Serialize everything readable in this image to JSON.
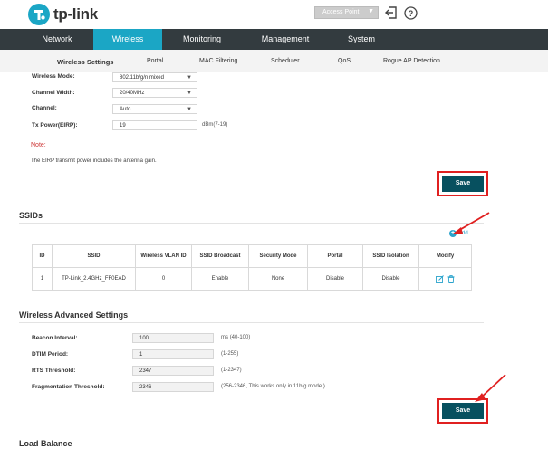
{
  "header": {
    "brand": "tp-link",
    "mode_select": "Access Point",
    "colors": {
      "brand_teal": "#1ba6c5",
      "nav_bg": "#333b3f"
    }
  },
  "main_nav": [
    "Network",
    "Wireless",
    "Monitoring",
    "Management",
    "System"
  ],
  "main_nav_active": "Wireless",
  "sub_nav": [
    "Wireless Settings",
    "Portal",
    "MAC Filtering",
    "Scheduler",
    "QoS",
    "Rogue AP Detection"
  ],
  "sub_nav_active": "Wireless Settings",
  "radio": {
    "mode_label": "Wireless Mode:",
    "mode_value": "802.11b/g/n mixed",
    "width_label": "Channel Width:",
    "width_value": "20/40MHz",
    "channel_label": "Channel:",
    "channel_value": "Auto",
    "txpower_label": "Tx Power(EIRP):",
    "txpower_value": "19",
    "txpower_hint": "dBm(7-19)",
    "note_title": "Note:",
    "note_text": "The EIRP transmit power includes the antenna gain.",
    "save": "Save"
  },
  "ssids": {
    "title": "SSIDs",
    "add": "Add",
    "columns": [
      "ID",
      "SSID",
      "Wireless VLAN ID",
      "SSID Broadcast",
      "Security Mode",
      "Portal",
      "SSID Isolation",
      "Modify"
    ],
    "rows": [
      {
        "id": "1",
        "ssid": "TP-Link_2.4GHz_FF0EAD",
        "vlan": "0",
        "broadcast": "Enable",
        "security": "None",
        "portal": "Disable",
        "isolation": "Disable"
      }
    ]
  },
  "advanced": {
    "title": "Wireless Advanced Settings",
    "beacon_label": "Beacon Interval:",
    "beacon_value": "100",
    "beacon_hint": "ms (40-100)",
    "dtim_label": "DTIM Period:",
    "dtim_value": "1",
    "dtim_hint": "(1-255)",
    "rts_label": "RTS Threshold:",
    "rts_value": "2347",
    "rts_hint": "(1-2347)",
    "frag_label": "Fragmentation Threshold:",
    "frag_value": "2346",
    "frag_hint": "(256-2346, This works only in 11b/g mode.)",
    "save": "Save"
  },
  "load_balance_title": "Load Balance"
}
